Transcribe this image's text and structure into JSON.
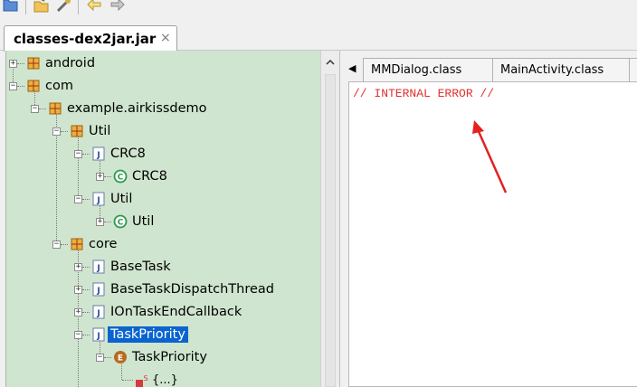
{
  "file_tab": {
    "label": "classes-dex2jar.jar",
    "close_glyph": "×"
  },
  "toolbar": {
    "buttons": [
      {
        "icon": "open-folder-icon"
      },
      {
        "icon": "open-file-icon"
      },
      {
        "icon": "tools-icon"
      },
      {
        "icon": "back-arrow-icon"
      },
      {
        "icon": "forward-arrow-icon"
      }
    ]
  },
  "tree": [
    {
      "label": "android",
      "icon": "package-icon"
    },
    {
      "label": "com",
      "icon": "package-icon"
    },
    {
      "label": "example.airkissdemo",
      "icon": "package-icon"
    },
    {
      "label": "Util",
      "icon": "package-icon"
    },
    {
      "label": "CRC8",
      "icon": "java-file-icon"
    },
    {
      "label": "CRC8",
      "icon": "class-icon"
    },
    {
      "label": "Util",
      "icon": "java-file-icon"
    },
    {
      "label": "Util",
      "icon": "class-icon"
    },
    {
      "label": "core",
      "icon": "package-icon"
    },
    {
      "label": "BaseTask",
      "icon": "java-file-icon"
    },
    {
      "label": "BaseTaskDispatchThread",
      "icon": "java-file-icon"
    },
    {
      "label": "IOnTaskEndCallback",
      "icon": "java-file-icon"
    },
    {
      "label": "TaskPriority",
      "icon": "java-file-icon",
      "selected": true
    },
    {
      "label": "TaskPriority",
      "icon": "enum-icon"
    },
    {
      "label": "{...}",
      "icon": "static-block-icon"
    }
  ],
  "editor": {
    "tabs": [
      {
        "label": "MMDialog.class"
      },
      {
        "label": "MainActivity.class"
      }
    ],
    "tab_nav_glyph": "◀",
    "content": "// INTERNAL ERROR //"
  },
  "colors": {
    "tree_background": "#cfe5cf",
    "selection": "#0a64d0",
    "error_text": "#e03030",
    "annotation_arrow": "#e52020"
  }
}
